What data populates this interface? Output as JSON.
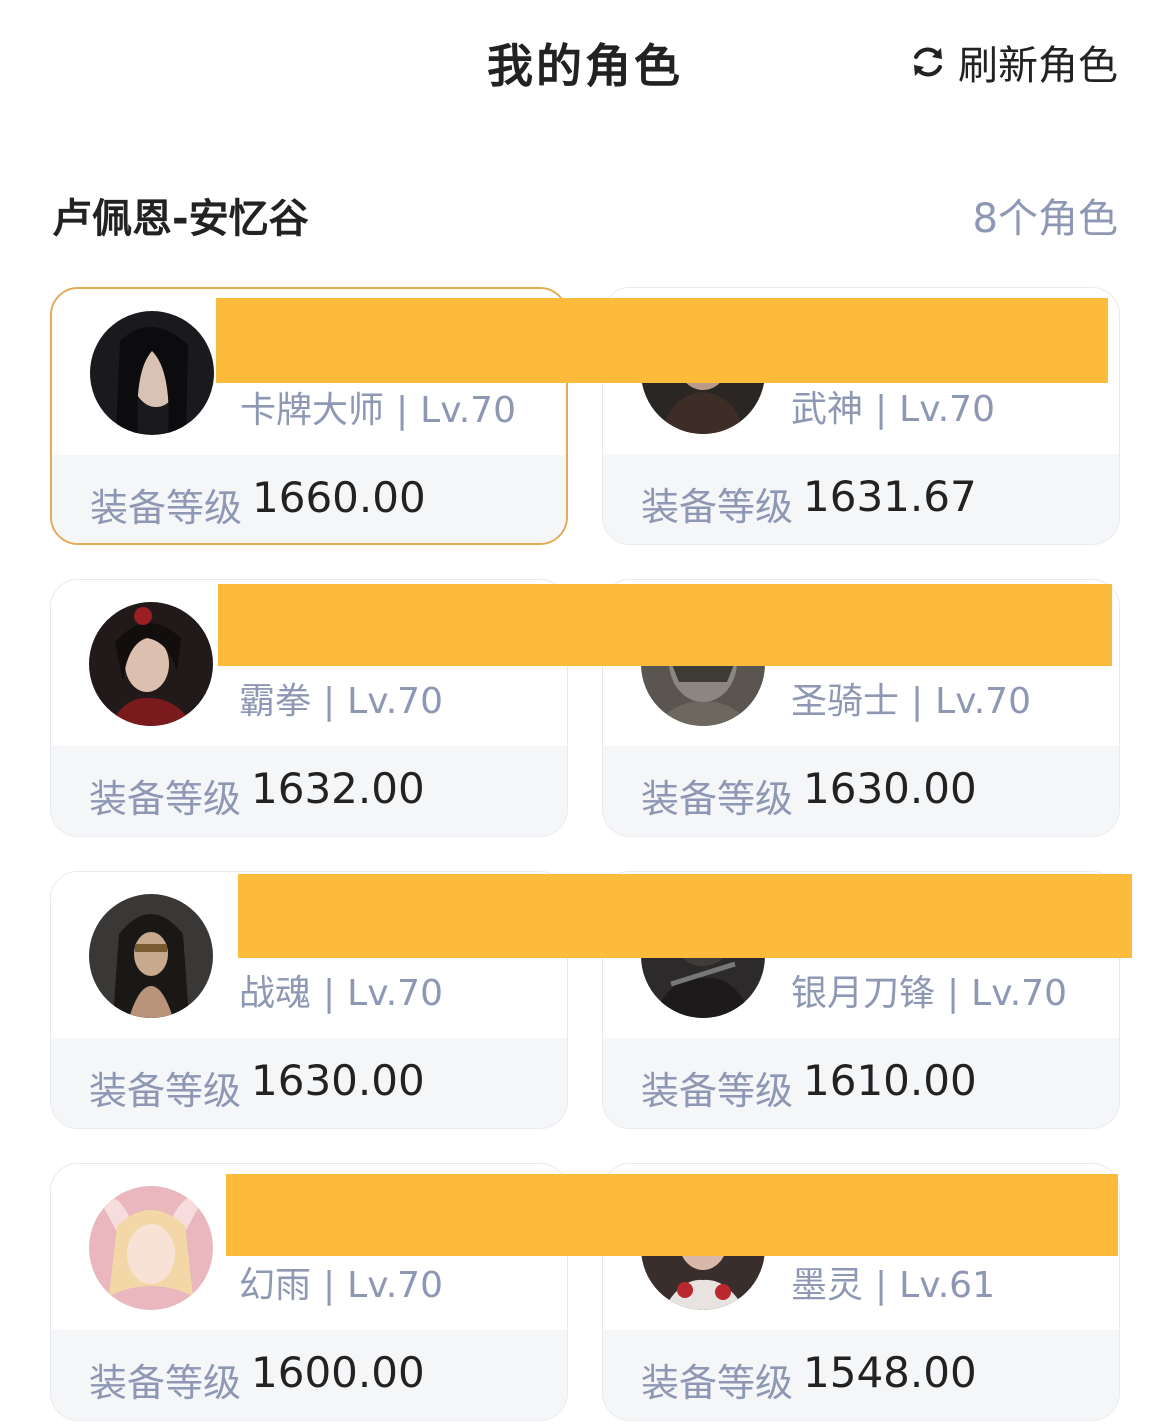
{
  "header": {
    "title": "我的角色",
    "refresh_label": "刷新角色"
  },
  "server": {
    "name": "卢佩恩-安忆谷",
    "count": "8个角色"
  },
  "equip_label": "装备等级",
  "level_sep": "|",
  "roles": [
    {
      "class": "卡牌大师",
      "level": "Lv.70",
      "equip": "1660.00",
      "selected": true
    },
    {
      "class": "武神",
      "level": "Lv.70",
      "equip": "1631.67",
      "selected": false
    },
    {
      "class": "霸拳",
      "level": "Lv.70",
      "equip": "1632.00",
      "selected": false
    },
    {
      "class": "圣骑士",
      "level": "Lv.70",
      "equip": "1630.00",
      "selected": false
    },
    {
      "class": "战魂",
      "level": "Lv.70",
      "equip": "1630.00",
      "selected": false
    },
    {
      "class": "银月刀锋",
      "level": "Lv.70",
      "equip": "1610.00",
      "selected": false
    },
    {
      "class": "幻雨",
      "level": "Lv.70",
      "equip": "1600.00",
      "selected": false
    },
    {
      "class": "墨灵",
      "level": "Lv.61",
      "equip": "1548.00",
      "selected": false
    }
  ],
  "colors": {
    "selected_border": "#e6aa57",
    "muted_text": "#8e97b3",
    "redaction": "#fdbb3c"
  }
}
